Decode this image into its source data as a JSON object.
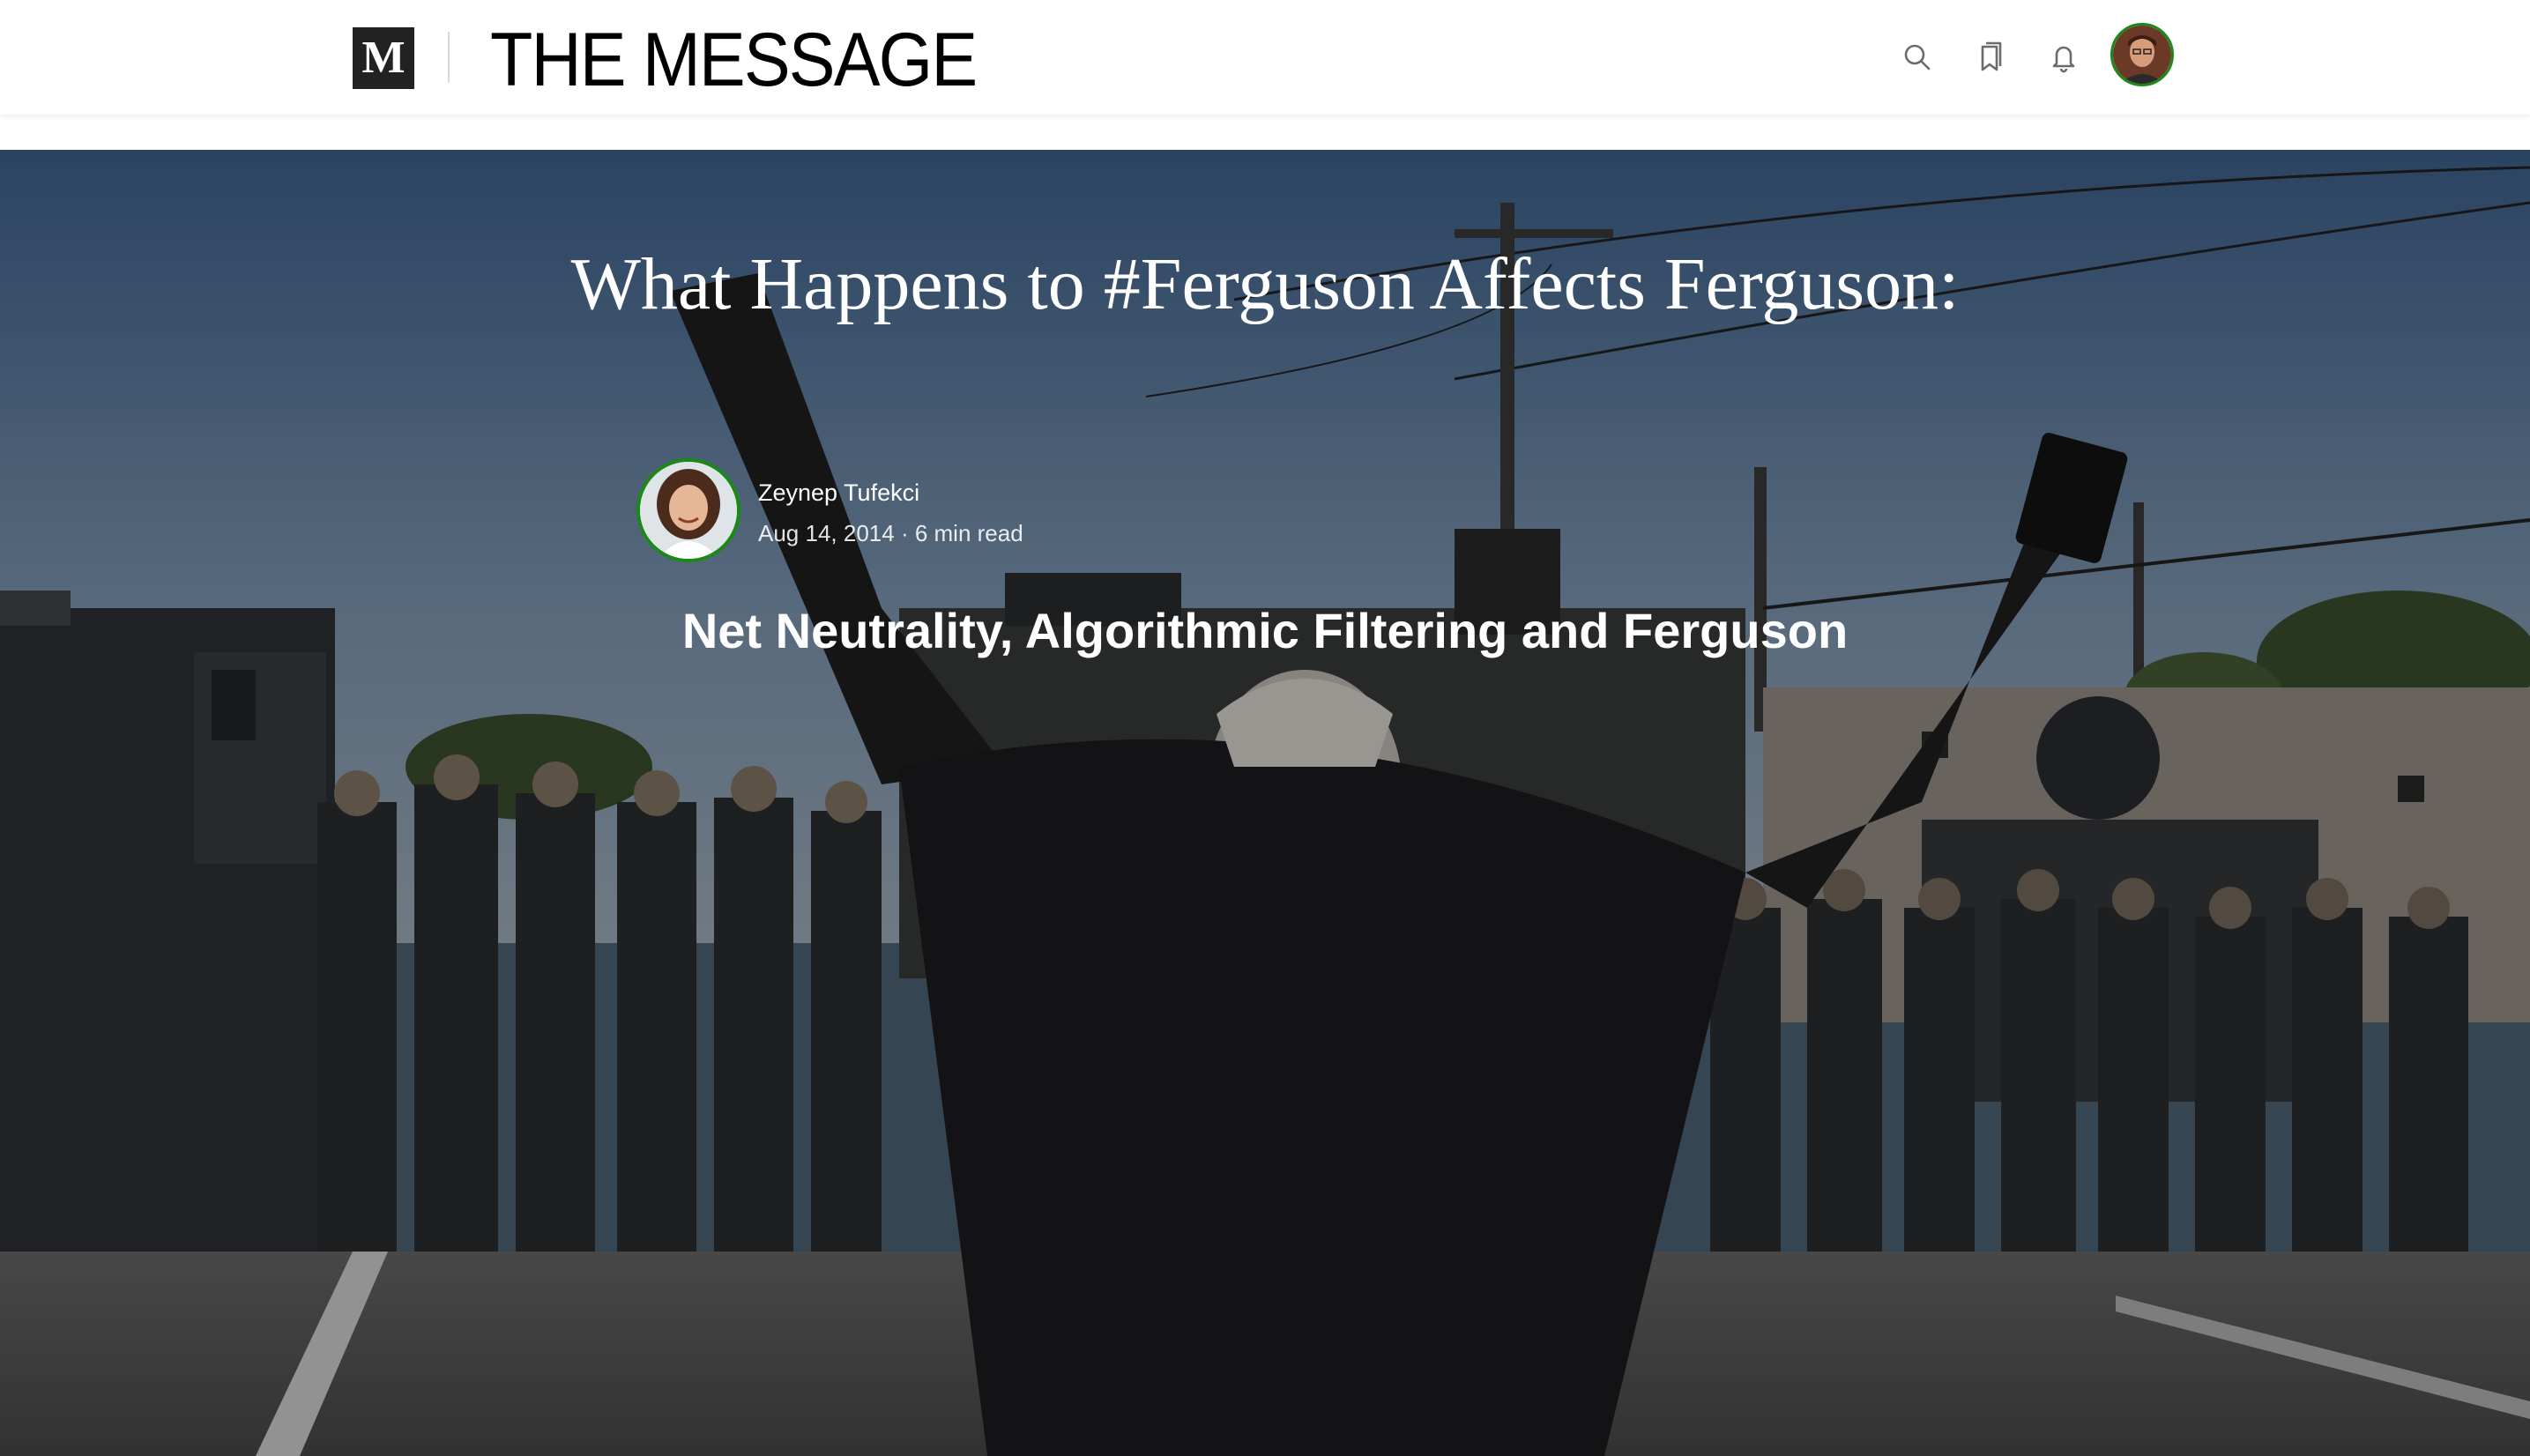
{
  "header": {
    "medium_logo": "M",
    "publication_name": "THE MESSAGE",
    "icons": [
      "search-icon",
      "bookmarks-icon",
      "bell-icon"
    ],
    "user_avatar": "user-avatar"
  },
  "article": {
    "title": "What Happens to #Ferguson Affects Ferguson:",
    "author": {
      "name": "Zeynep Tufekci",
      "date": "Aug 14, 2014",
      "separator": "·",
      "read_time": "6 min read"
    },
    "subtitle": "Net Neutrality, Algorithmic Filtering and Ferguson"
  },
  "colors": {
    "accent_green": "#1a8917",
    "header_bg": "#ffffff",
    "logo_bg": "#222222",
    "hero_text": "#ffffff"
  }
}
